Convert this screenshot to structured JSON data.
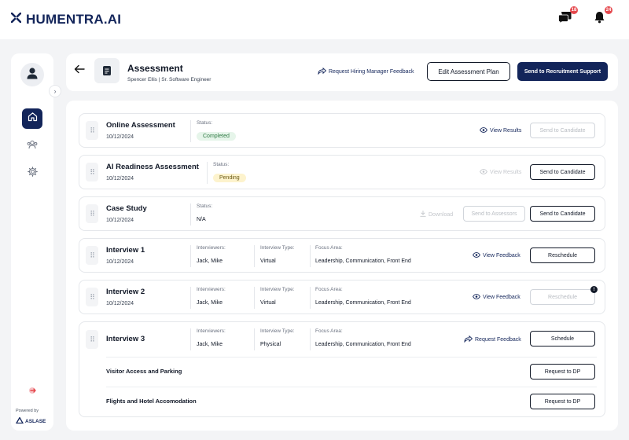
{
  "app": {
    "name": "HUMENTRA.AI",
    "chat_badge": "18",
    "bell_badge": "24"
  },
  "sidebar": {
    "powered_by": "Powered by",
    "brand": "ASLASE"
  },
  "header": {
    "title": "Assessment",
    "subtitle": "Spencer Ellis | Sr. Software Engineer",
    "request_feedback": "Request Hiring Manager Feedback",
    "edit_plan": "Edit Assessment Plan",
    "send_recruitment": "Send to Recruitment Support"
  },
  "stages": {
    "online": {
      "name": "Online Assessment",
      "date": "10/12/2024",
      "status_label": "Status:",
      "status": "Completed",
      "view_results": "View Results",
      "send_candidate": "Send to Candidate"
    },
    "ai": {
      "name": "AI Readiness Assessment",
      "date": "10/12/2024",
      "status_label": "Status:",
      "status": "Pending",
      "view_results": "View Results",
      "send_candidate": "Send to Candidate"
    },
    "case": {
      "name": "Case Study",
      "date": "10/12/2024",
      "status_label": "Status:",
      "status": "N/A",
      "download": "Download",
      "send_assessors": "Send to Assessors",
      "send_candidate": "Send to Candidate"
    },
    "interview1": {
      "name": "Interview 1",
      "date": "10/12/2024",
      "interviewers_label": "Interviewers:",
      "interviewers": "Jack, Mike",
      "type_label": "Interview Type:",
      "type": "Virtual",
      "focus_label": "Focus Area:",
      "focus": "Leadership, Communication, Front End",
      "view_feedback": "View Feedback",
      "action": "Reschedule"
    },
    "interview2": {
      "name": "Interview 2",
      "date": "10/12/2024",
      "interviewers_label": "Interviewers:",
      "interviewers": "Jack, Mike",
      "type_label": "Interview Type:",
      "type": "Virtual",
      "focus_label": "Focus Area:",
      "focus": "Leadership, Communication, Front End",
      "view_feedback": "View Feedback",
      "action": "Reschedule",
      "notif": "!"
    },
    "interview3": {
      "name": "Interview 3",
      "interviewers_label": "Interviewers:",
      "interviewers": "Jack, Mike",
      "type_label": "Interview Type:",
      "type": "Physical",
      "focus_label": "Focus Area:",
      "focus": "Leadership, Communication, Front End",
      "request_feedback": "Request Feedback",
      "action": "Schedule",
      "visitor_label": "Visitor Access and Parking",
      "visitor_action": "Request to DP",
      "flights_label": "Flights and Hotel Accomodation",
      "flights_action": "Request to DP"
    }
  },
  "colors": {
    "brand": "#13255a",
    "completed_bg": "#e6f5ea",
    "pending_bg": "#fdf3cd",
    "badge": "#e5484d"
  },
  "icons": [
    "logo-mark-icon",
    "chat-icon",
    "bell-icon",
    "user-icon",
    "chevron-right-icon",
    "home-icon",
    "users-icon",
    "gear-icon",
    "logout-icon",
    "back-arrow-icon",
    "document-icon",
    "send-arrow-icon",
    "eye-icon",
    "download-icon",
    "drag-handle-icon"
  ]
}
